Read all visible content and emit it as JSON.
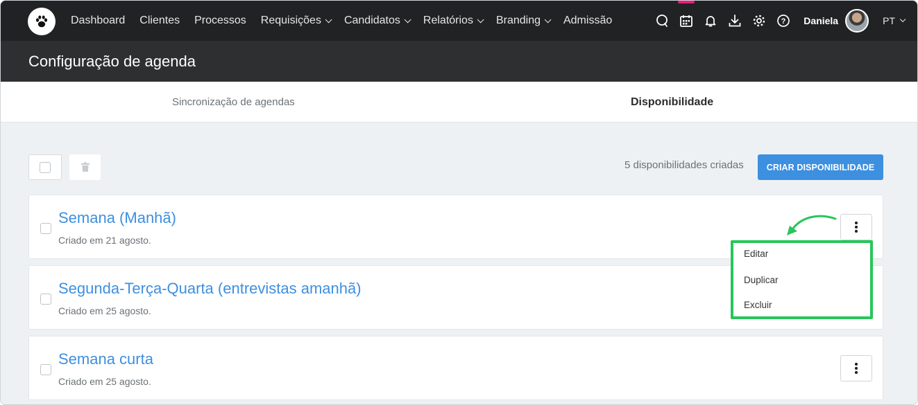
{
  "nav": {
    "items": [
      {
        "label": "Dashboard",
        "dropdown": false
      },
      {
        "label": "Clientes",
        "dropdown": false
      },
      {
        "label": "Processos",
        "dropdown": false
      },
      {
        "label": "Requisições",
        "dropdown": true
      },
      {
        "label": "Candidatos",
        "dropdown": true
      },
      {
        "label": "Relatórios",
        "dropdown": true
      },
      {
        "label": "Branding",
        "dropdown": true
      },
      {
        "label": "Admissão",
        "dropdown": false
      }
    ],
    "icons": [
      "chat-icon",
      "calendar-icon",
      "bell-icon",
      "download-icon",
      "gear-icon",
      "help-icon"
    ],
    "user_name": "Daniela",
    "language": "PT"
  },
  "page": {
    "title": "Configuração de agenda"
  },
  "tabs": [
    {
      "label": "Sincronização de agendas",
      "active": false
    },
    {
      "label": "Disponibilidade",
      "active": true
    }
  ],
  "toolbar": {
    "count_text": "5 disponibilidades criadas",
    "create_label": "CRIAR DISPONIBILIDADE"
  },
  "availabilities": [
    {
      "title": "Semana (Manhã)",
      "created": "Criado em 21 agosto."
    },
    {
      "title": "Segunda-Terça-Quarta (entrevistas amanhã)",
      "created": "Criado em 25 agosto."
    },
    {
      "title": "Semana curta",
      "created": "Criado em 25 agosto."
    }
  ],
  "menu": {
    "items": [
      "Editar",
      "Duplicar",
      "Excluir"
    ]
  },
  "colors": {
    "accent": "#3d8fe0",
    "highlight": "#27c65a",
    "nav_bg": "#212224",
    "calendar_indicator": "#e91e7a"
  }
}
